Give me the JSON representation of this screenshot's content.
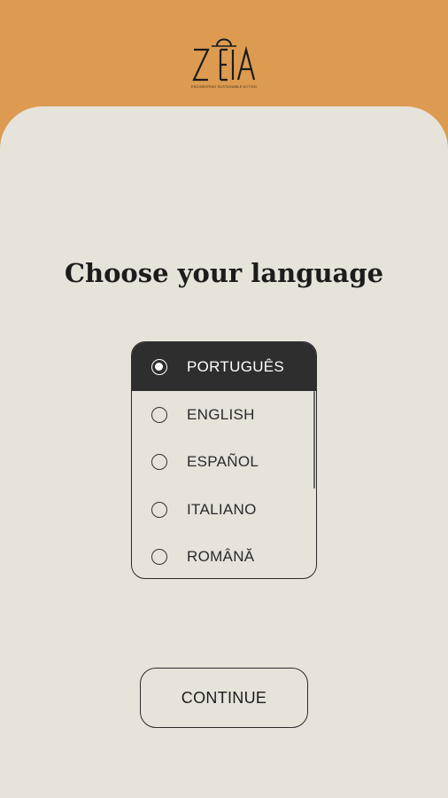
{
  "header": {
    "logo": {
      "wordmark": "ZEIA",
      "tagline": "ENGINEERING SUSTAINABLE ACTION",
      "icon": "shopping-bag-logo-icon"
    }
  },
  "main": {
    "title": "Choose your language",
    "languages": [
      {
        "label": "PORTUGUÊS",
        "selected": true
      },
      {
        "label": "ENGLISH",
        "selected": false
      },
      {
        "label": "ESPAÑOL",
        "selected": false
      },
      {
        "label": "ITALIANO",
        "selected": false
      },
      {
        "label": "ROMÂNĂ",
        "selected": false
      }
    ],
    "continue_label": "CONTINUE"
  },
  "colors": {
    "header_background": "#DC9B50",
    "panel_background": "#E5E3DA",
    "selected_row": "#2E2E2E",
    "text": "#1C1C1C"
  }
}
